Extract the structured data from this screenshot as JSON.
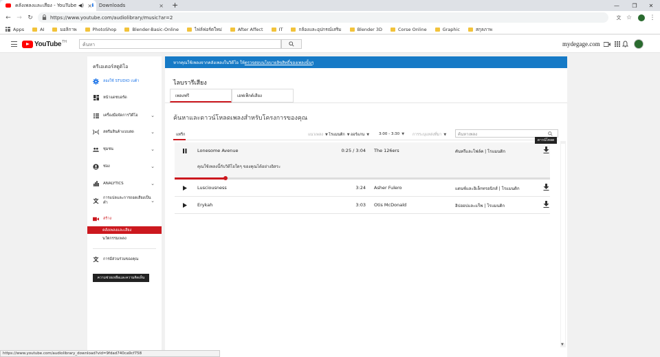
{
  "browser": {
    "tabs": [
      {
        "title": "คลังเพลงและเสียง - YouTube"
      },
      {
        "title": "Downloads"
      }
    ],
    "new_tab": "+",
    "url": "https://www.youtube.com/audiolibrary/music?ar=2",
    "bookmarks": [
      "Apps",
      "AI",
      "มอลิกาพ",
      "PhotoShop",
      "Blender-Basic-Online",
      "ไฟล์ฟอร์ตใหม่",
      "After Affect",
      "IT",
      "กล้องและอุปกรณ์เสริม",
      "Blender 3D",
      "Corse Online",
      "Graphic",
      "สกุลภาพ"
    ],
    "status_url": "https://www.youtube.com/audiolibrary_download?vid=9fdad740ca9cf758"
  },
  "header": {
    "logo": "YouTube",
    "logo_sup": "TH",
    "search_placeholder": "ค้นหา",
    "channel_name": "mydegage.com"
  },
  "sidebar": {
    "title": "ครีเอเตอร์สตูดิโอ",
    "items": [
      {
        "label": "ลองใช้ STUDIO เบต้า",
        "icon": "gear-icon"
      },
      {
        "label": "หน้าแดชบอร์ด",
        "icon": "dashboard-icon"
      },
      {
        "label": "เครื่องมือจัดการวิดีโอ",
        "icon": "video-manager-icon"
      },
      {
        "label": "สตรีมสินค้าแบบสด",
        "icon": "live-icon"
      },
      {
        "label": "ชุมชน",
        "icon": "community-icon"
      },
      {
        "label": "ช่อง",
        "icon": "channel-icon"
      },
      {
        "label": "ANALYTICS",
        "icon": "analytics-icon"
      },
      {
        "label": "การแปลและการถอดเสียงเป็นคำ",
        "icon": "translate-icon"
      },
      {
        "label": "สร้าง",
        "icon": "create-icon"
      }
    ],
    "sub_items": [
      "คลังเพลงและเสียง",
      "นวัตกรรมเพลง"
    ],
    "contrib_label": "การมีส่วนร่วมของคุณ",
    "feedback_button": "ความช่วยเหลือและความคิดเห็น"
  },
  "main": {
    "banner_text": "หากคุณใช้เพลงจากคลังเพลงในวิดีโอ ให้",
    "banner_link": "ตรวจสอบนโยบายลิขสิทธิ์ของเพลงนั้นๆ",
    "page_title": "ไลบรารีเสียง",
    "tabs": [
      "เพลงฟรี",
      "เอฟเฟ็กต์เสียง"
    ],
    "subtitle": "ค้นหาและดาวน์โหลดเพลงสำหรับโครงการของคุณ",
    "filters": {
      "tab": "แทร็ก",
      "genre": "แนวเพลง",
      "mood": "โรแมนติก",
      "instrument": "ออร์แกน",
      "duration": "3:00 - 3:30",
      "attribution": "การระบุแหล่งที่มา",
      "search_placeholder": "ค้นหาเพลง"
    },
    "tracks": [
      {
        "name": "Lonesome Avenue",
        "time": "0:25 / 3:04",
        "artist": "The 126ers",
        "genre": "คันทรีและโฟล์ค | โรแมนติก",
        "desc": "คุณใช้เพลงนี้กับวิดีโอใดๆ ของคุณได้อย่างอิสระ",
        "expanded": true,
        "progress": 0.136
      },
      {
        "name": "Lusciousness",
        "time": "3:24",
        "artist": "Asher Fulero",
        "genre": "แดนซ์และอิเล็กทรอนิกส์ | โรแมนติก",
        "expanded": false
      },
      {
        "name": "Erykah",
        "time": "3:03",
        "artist": "Otis McDonald",
        "genre": "ฮิปฮอปและแร็พ | โรแมนติก",
        "expanded": false
      }
    ],
    "download_tooltip": "ดาวน์โหลด"
  }
}
